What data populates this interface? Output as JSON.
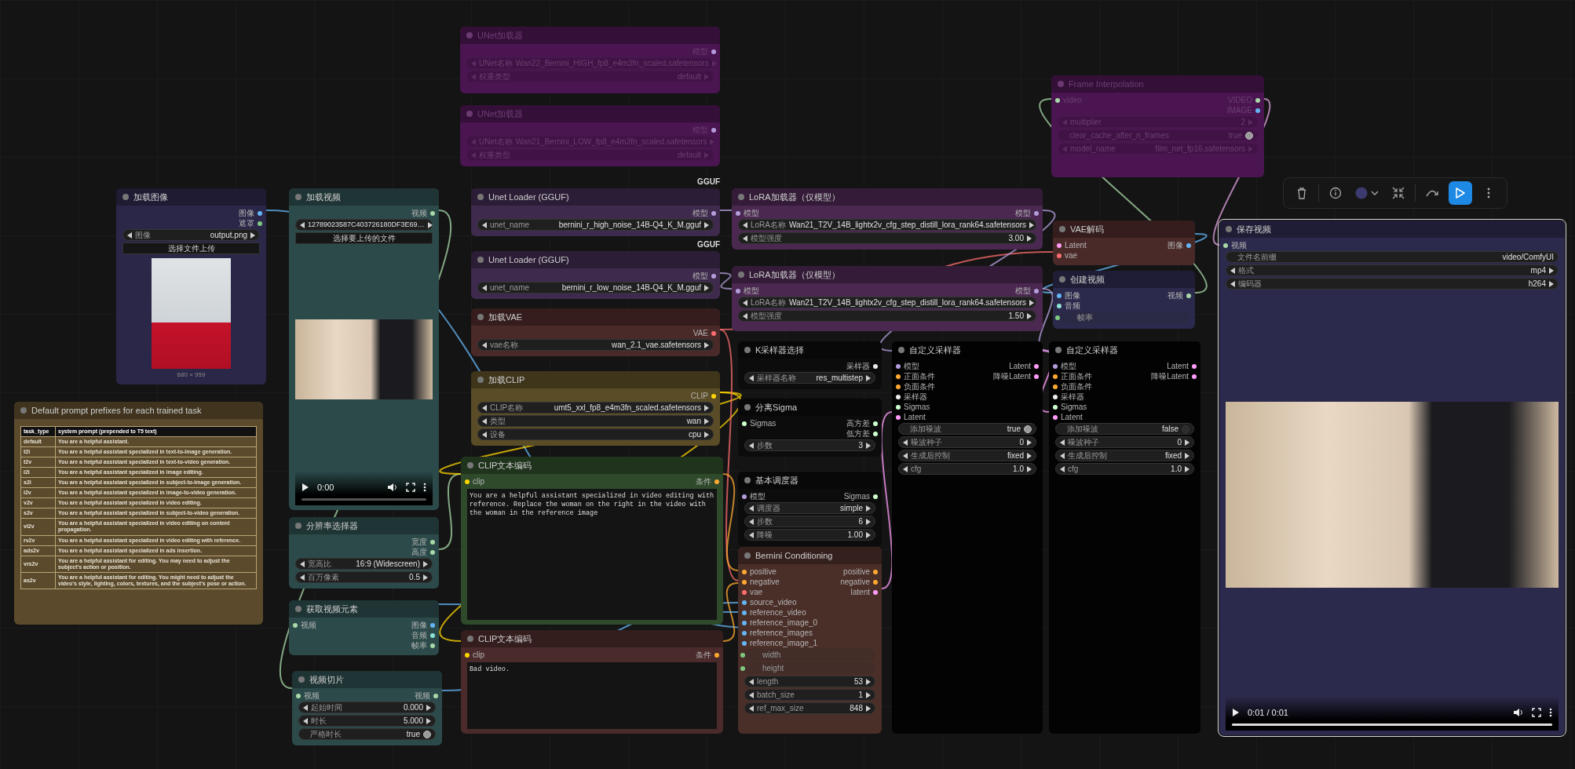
{
  "nodes": [
    {
      "title": "加载图像",
      "color": "#2b2748",
      "bypassed": false,
      "selected": false,
      "outputs": [
        {
          "label": "图像",
          "color": "#64b5f6"
        },
        {
          "label": "遮罩",
          "color": "#81c784"
        }
      ],
      "widgets": [
        {
          "kind": "combo",
          "label": "图像",
          "value": "output.png"
        },
        {
          "kind": "button",
          "label": "选择文件上传"
        }
      ],
      "preview": {
        "kind": "image",
        "caption": "680 × 959"
      }
    },
    {
      "title": "加载视频",
      "color": "#2c4a4a",
      "bypassed": false,
      "selected": false,
      "outputs": [
        {
          "label": "视频",
          "color": "#a8d8a8"
        }
      ],
      "widgets": [
        {
          "kind": "combo",
          "value": "12789023587C403726180DF3E69…"
        },
        {
          "kind": "button",
          "label": "选择要上传的文件"
        }
      ],
      "preview": {
        "kind": "video",
        "time": "0:00",
        "level": 0
      }
    },
    {
      "title": "Default prompt prefixes for each trained task",
      "color": "#5b4a2c",
      "bypassed": false,
      "selected": false,
      "table": {
        "columns": [
          "task_type",
          "system prompt (prepended to T5 text)"
        ],
        "rows": [
          [
            "default",
            "You are a helpful assistant."
          ],
          [
            "t2i",
            "You are a helpful assistant specialized in text-to-image generation."
          ],
          [
            "t2v",
            "You are a helpful assistant specialized in text-to-video generation."
          ],
          [
            "i2i",
            "You are a helpful assistant specialized in image editing."
          ],
          [
            "s2i",
            "You are a helpful assistant specialized in subject-to-image generation."
          ],
          [
            "i2v",
            "You are a helpful assistant specialized in image-to-video generation."
          ],
          [
            "v2v",
            "You are a helpful assistant specialized in video editing."
          ],
          [
            "s2v",
            "You are a helpful assistant specialized in subject-to-video generation."
          ],
          [
            "vi2v",
            "You are a helpful assistant specialized in video editing on content propagation."
          ],
          [
            "rv2v",
            "You are a helpful assistant specialized in video editing with reference."
          ],
          [
            "ads2v",
            "You are a helpful assistant specialized in ads insertion."
          ],
          [
            "vrs2v",
            "You are a helpful assistant for editing. You may need to adjust the subject's action or position."
          ],
          [
            "as2v",
            "You are a helpful assistant for editing. You might need to adjust the video's style, lighting, colors, textures, and the subject's pose or action."
          ]
        ]
      }
    },
    {
      "title": "分辨率选择器",
      "color": "#2c4a4a",
      "bypassed": false,
      "selected": false,
      "outputs": [
        {
          "label": "宽度",
          "color": "#a8d8a8"
        },
        {
          "label": "高度",
          "color": "#a8d8a8"
        }
      ],
      "widgets": [
        {
          "kind": "combo",
          "label": "宽高比",
          "value": "16:9 (Widescreen)"
        },
        {
          "kind": "number",
          "label": "百万像素",
          "value": "0.5"
        }
      ]
    },
    {
      "title": "获取视频元素",
      "color": "#2c4a4a",
      "bypassed": false,
      "selected": false,
      "inputs": [
        {
          "label": "视频",
          "color": "#a8d8a8"
        }
      ],
      "outputs": [
        {
          "label": "图像",
          "color": "#64b5f6"
        },
        {
          "label": "音频",
          "color": "#8fe3d6"
        },
        {
          "label": "帧率",
          "color": "#a8d8a8"
        }
      ]
    },
    {
      "title": "视频切片",
      "color": "#2c4a4a",
      "bypassed": false,
      "selected": false,
      "inputs": [
        {
          "label": "视频",
          "color": "#a8d8a8"
        }
      ],
      "outputs": [
        {
          "label": "视频",
          "color": "#a8d8a8"
        }
      ],
      "widgets": [
        {
          "kind": "number",
          "label": "起始时间",
          "value": "0.000"
        },
        {
          "kind": "number",
          "label": "时长",
          "value": "5.000"
        },
        {
          "kind": "toggle",
          "label": "严格时长",
          "value": "true",
          "on": true
        }
      ]
    },
    {
      "title": "UNet加载器",
      "color": "#4a1550",
      "bypassed": true,
      "selected": false,
      "outputs": [
        {
          "label": "模型",
          "color": "#b39ddb"
        }
      ],
      "widgets": [
        {
          "kind": "combo",
          "label": "UNet名称",
          "value": "Wan22_Bernini_HIGH_fp8_e4m3fn_scaled.safetensors"
        },
        {
          "kind": "combo",
          "label": "权重类型",
          "value": "default"
        }
      ]
    },
    {
      "title": "UNet加载器",
      "color": "#4a1550",
      "bypassed": true,
      "selected": false,
      "outputs": [
        {
          "label": "模型",
          "color": "#b39ddb"
        }
      ],
      "widgets": [
        {
          "kind": "combo",
          "label": "UNet名称",
          "value": "Wan21_Bernini_LOW_fp8_e4m3fn_scaled.safetensors"
        },
        {
          "kind": "combo",
          "label": "权重类型",
          "value": "default"
        }
      ]
    },
    {
      "title": "Unet Loader (GGUF)",
      "color": "#3e2a4c",
      "bypassed": false,
      "selected": false,
      "badge": "GGUF",
      "outputs": [
        {
          "label": "模型",
          "color": "#b39ddb"
        }
      ],
      "widgets": [
        {
          "kind": "combo",
          "label": "unet_name",
          "value": "bernini_r_high_noise_14B-Q4_K_M.gguf"
        }
      ]
    },
    {
      "title": "Unet Loader (GGUF)",
      "color": "#3e2a4c",
      "bypassed": false,
      "selected": false,
      "badge": "GGUF",
      "outputs": [
        {
          "label": "模型",
          "color": "#b39ddb"
        }
      ],
      "widgets": [
        {
          "kind": "combo",
          "label": "unet_name",
          "value": "bernini_r_low_noise_14B-Q4_K_M.gguf"
        }
      ]
    },
    {
      "title": "加载VAE",
      "color": "#4a2a28",
      "bypassed": false,
      "selected": false,
      "outputs": [
        {
          "label": "VAE",
          "color": "#ff6e6e"
        }
      ],
      "widgets": [
        {
          "kind": "combo",
          "label": "vae名称",
          "value": "wan_2.1_vae.safetensors"
        }
      ]
    },
    {
      "title": "加载CLIP",
      "color": "#5a4c26",
      "bypassed": false,
      "selected": false,
      "outputs": [
        {
          "label": "CLIP",
          "color": "#ffd500"
        }
      ],
      "widgets": [
        {
          "kind": "combo",
          "label": "CLIP名称",
          "value": "umt5_xxl_fp8_e4m3fn_scaled.safetensors"
        },
        {
          "kind": "combo",
          "label": "类型",
          "value": "wan"
        },
        {
          "kind": "combo",
          "label": "设备",
          "value": "cpu"
        }
      ]
    },
    {
      "title": "CLIP文本编码",
      "color": "#2e4a2a",
      "bypassed": false,
      "selected": false,
      "inputs": [
        {
          "label": "clip",
          "color": "#ffd500"
        }
      ],
      "outputs": [
        {
          "label": "条件",
          "color": "#ffa931"
        }
      ],
      "prompt": "You are a helpful assistant specialized in video editing with reference. Replace the woman on the right in the video with the woman in the reference image"
    },
    {
      "title": "CLIP文本编码",
      "color": "#4a2a2a",
      "bypassed": false,
      "selected": false,
      "inputs": [
        {
          "label": "clip",
          "color": "#ffd500"
        }
      ],
      "outputs": [
        {
          "label": "条件",
          "color": "#ffa931"
        }
      ],
      "prompt": "Bad video."
    },
    {
      "title": "LoRA加载器（仅模型）",
      "color": "#4a2850",
      "bypassed": false,
      "selected": false,
      "inputs": [
        {
          "label": "模型",
          "color": "#b39ddb"
        }
      ],
      "outputs": [
        {
          "label": "模型",
          "color": "#b39ddb"
        }
      ],
      "widgets": [
        {
          "kind": "combo",
          "label": "LoRA名称",
          "value": "Wan21_T2V_14B_lightx2v_cfg_step_distill_lora_rank64.safetensors"
        },
        {
          "kind": "number",
          "label": "模型强度",
          "value": "3.00"
        }
      ]
    },
    {
      "title": "LoRA加载器（仅模型）",
      "color": "#4a2850",
      "bypassed": false,
      "selected": false,
      "inputs": [
        {
          "label": "模型",
          "color": "#b39ddb"
        }
      ],
      "outputs": [
        {
          "label": "模型",
          "color": "#b39ddb"
        }
      ],
      "widgets": [
        {
          "kind": "combo",
          "label": "LoRA名称",
          "value": "Wan21_T2V_14B_lightx2v_cfg_step_distill_lora_rank64.safetensors"
        },
        {
          "kind": "number",
          "label": "模型强度",
          "value": "1.50"
        }
      ]
    },
    {
      "title": "K采样器选择",
      "color": "#0c0c0c",
      "bypassed": false,
      "selected": false,
      "outputs": [
        {
          "label": "采样器",
          "color": "#ececec"
        }
      ],
      "widgets": [
        {
          "kind": "combo",
          "label": "采样器名称",
          "value": "res_multistep"
        }
      ]
    },
    {
      "title": "分离Sigma",
      "color": "#0c0c0c",
      "bypassed": false,
      "selected": false,
      "inputs": [
        {
          "label": "Sigmas",
          "color": "#cdffcd"
        }
      ],
      "outputs": [
        {
          "label": "高方差",
          "color": "#cdffcd"
        },
        {
          "label": "低方差",
          "color": "#cdffcd"
        }
      ],
      "widgets": [
        {
          "kind": "number",
          "label": "步数",
          "value": "3"
        }
      ]
    },
    {
      "title": "基本调度器",
      "color": "#0c0c0c",
      "bypassed": false,
      "selected": false,
      "inputs": [
        {
          "label": "模型",
          "color": "#b39ddb"
        }
      ],
      "outputs": [
        {
          "label": "Sigmas",
          "color": "#cdffcd"
        }
      ],
      "widgets": [
        {
          "kind": "combo",
          "label": "调度器",
          "value": "simple"
        },
        {
          "kind": "number",
          "label": "步数",
          "value": "6"
        },
        {
          "kind": "number",
          "label": "降噪",
          "value": "1.00"
        }
      ]
    },
    {
      "title": "Bernini Conditioning",
      "color": "#4a2e28",
      "bypassed": false,
      "selected": false,
      "inputs": [
        {
          "label": "positive",
          "color": "#ffa931"
        },
        {
          "label": "negative",
          "color": "#ffa931"
        },
        {
          "label": "vae",
          "color": "#ff6e6e"
        },
        {
          "label": "source_video",
          "color": "#64b5f6"
        },
        {
          "label": "reference_video",
          "color": "#64b5f6"
        },
        {
          "label": "reference_image_0",
          "color": "#64b5f6"
        },
        {
          "label": "reference_images",
          "color": "#64b5f6"
        },
        {
          "label": "reference_image_1",
          "color": "#64b5f6"
        }
      ],
      "outputs": [
        {
          "label": "positive",
          "color": "#ffa931"
        },
        {
          "label": "negative",
          "color": "#ffa931"
        },
        {
          "label": "latent",
          "color": "#ff9cf9"
        }
      ],
      "widgets": [
        {
          "kind": "linked",
          "label": "width",
          "color": "#7fc97f"
        },
        {
          "kind": "linked",
          "label": "height",
          "color": "#7fc97f"
        },
        {
          "kind": "number",
          "label": "length",
          "value": "53"
        },
        {
          "kind": "number",
          "label": "batch_size",
          "value": "1"
        },
        {
          "kind": "number",
          "label": "ref_max_size",
          "value": "848"
        }
      ]
    },
    {
      "title": "Frame Interpolation",
      "color": "#4a1550",
      "bypassed": true,
      "selected": false,
      "inputs": [
        {
          "label": "video",
          "color": "#a8d8a8"
        }
      ],
      "outputs": [
        {
          "label": "VIDEO",
          "color": "#a8d8a8"
        },
        {
          "label": "IMAGE",
          "color": "#64b5f6"
        }
      ],
      "widgets": [
        {
          "kind": "number",
          "label": "multiplier",
          "value": "2"
        },
        {
          "kind": "toggle",
          "label": "clear_cache_after_n_frames",
          "value": "true",
          "on": true
        },
        {
          "kind": "combo",
          "label": "model_name",
          "value": "film_net_fp16.safetensors"
        }
      ]
    },
    {
      "title": "VAE解码",
      "color": "#4a2a28",
      "bypassed": false,
      "selected": false,
      "inputs": [
        {
          "label": "Latent",
          "color": "#ff9cf9"
        },
        {
          "label": "vae",
          "color": "#ff6e6e"
        }
      ],
      "outputs": [
        {
          "label": "图像",
          "color": "#64b5f6"
        }
      ]
    },
    {
      "title": "创建视频",
      "color": "#2b2a4c",
      "bypassed": false,
      "selected": false,
      "inputs": [
        {
          "label": "图像",
          "color": "#64b5f6"
        },
        {
          "label": "音频",
          "color": "#8fe3d6"
        }
      ],
      "outputs": [
        {
          "label": "视频",
          "color": "#a8d8a8"
        }
      ],
      "widgets": [
        {
          "kind": "linked",
          "label": "帧率",
          "color": "#7fc97f"
        }
      ]
    },
    {
      "title": "自定义采样器",
      "color": "#030303",
      "bypassed": false,
      "selected": false,
      "inputs": [
        {
          "label": "模型",
          "color": "#b39ddb"
        },
        {
          "label": "正面条件",
          "color": "#ffa931"
        },
        {
          "label": "负面条件",
          "color": "#ffa931"
        },
        {
          "label": "采样器",
          "color": "#ececec"
        },
        {
          "label": "Sigmas",
          "color": "#cdffcd"
        },
        {
          "label": "Latent",
          "color": "#ff9cf9"
        }
      ],
      "outputs": [
        {
          "label": "Latent",
          "color": "#ff9cf9"
        },
        {
          "label": "降噪Latent",
          "color": "#ff9cf9"
        }
      ],
      "widgets": [
        {
          "kind": "toggle",
          "label": "添加噪波",
          "value": "true",
          "on": true
        },
        {
          "kind": "number",
          "label": "噪波种子",
          "value": "0"
        },
        {
          "kind": "combo",
          "label": "生成后控制",
          "value": "fixed"
        },
        {
          "kind": "number",
          "label": "cfg",
          "value": "1.0"
        }
      ]
    },
    {
      "title": "自定义采样器",
      "color": "#030303",
      "bypassed": false,
      "selected": false,
      "inputs": [
        {
          "label": "模型",
          "color": "#b39ddb"
        },
        {
          "label": "正面条件",
          "color": "#ffa931"
        },
        {
          "label": "负面条件",
          "color": "#ffa931"
        },
        {
          "label": "采样器",
          "color": "#ececec"
        },
        {
          "label": "Sigmas",
          "color": "#cdffcd"
        },
        {
          "label": "Latent",
          "color": "#ff9cf9"
        }
      ],
      "outputs": [
        {
          "label": "Latent",
          "color": "#ff9cf9"
        },
        {
          "label": "降噪Latent",
          "color": "#ff9cf9"
        }
      ],
      "widgets": [
        {
          "kind": "toggle",
          "label": "添加噪波",
          "value": "false",
          "on": false
        },
        {
          "kind": "number",
          "label": "噪波种子",
          "value": "0"
        },
        {
          "kind": "combo",
          "label": "生成后控制",
          "value": "fixed"
        },
        {
          "kind": "number",
          "label": "cfg",
          "value": "1.0"
        }
      ]
    },
    {
      "title": "保存视频",
      "color": "#2c2a4c",
      "bypassed": false,
      "selected": true,
      "inputs": [
        {
          "label": "视频",
          "color": "#a8d8a8"
        }
      ],
      "widgets": [
        {
          "kind": "text",
          "label": "文件名前缀",
          "value": "video/ComfyUI"
        },
        {
          "kind": "combo",
          "label": "格式",
          "value": "mp4"
        },
        {
          "kind": "combo",
          "label": "编码器",
          "value": "h264"
        }
      ],
      "preview": {
        "kind": "video",
        "time": "0:01 / 0:01",
        "level": 1
      }
    }
  ]
}
